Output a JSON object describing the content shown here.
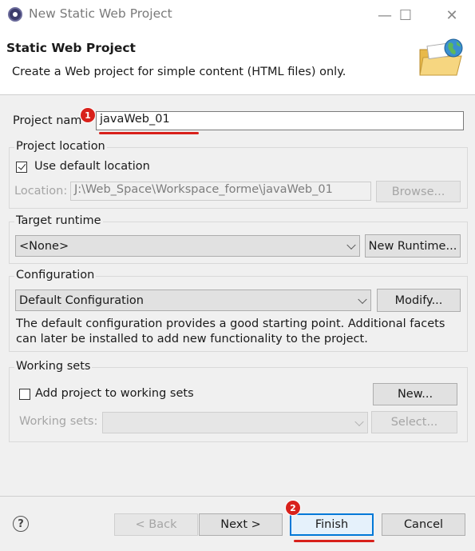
{
  "window": {
    "title": "New Static Web Project",
    "minimize_glyph": "—",
    "maximize_glyph": "☐",
    "close_glyph": "✕"
  },
  "header": {
    "title": "Static Web Project",
    "description": "Create a Web project for simple content (HTML files) only."
  },
  "project_name": {
    "label": "Project nam",
    "value": "javaWeb_01"
  },
  "project_location": {
    "group_label": "Project location",
    "use_default_label": "Use default location",
    "use_default_checked": true,
    "location_label": "Location:",
    "location_value": "J:\\Web_Space\\Workspace_forme\\javaWeb_01",
    "browse_label": "Browse..."
  },
  "target_runtime": {
    "group_label": "Target runtime",
    "selected": "<None>",
    "new_runtime_label": "New Runtime..."
  },
  "configuration": {
    "group_label": "Configuration",
    "selected": "Default Configuration",
    "modify_label": "Modify...",
    "description_line1": "The default configuration provides a good starting point. Additional facets",
    "description_line2": "can later be installed to add new functionality to the project."
  },
  "working_sets": {
    "group_label": "Working sets",
    "add_label": "Add project to working sets",
    "add_checked": false,
    "new_label": "New...",
    "sets_label": "Working sets:",
    "sets_value": "",
    "select_label": "Select..."
  },
  "footer": {
    "help_glyph": "?",
    "back_label": "< Back",
    "next_label": "Next >",
    "finish_label": "Finish",
    "cancel_label": "Cancel"
  },
  "annotations": {
    "badge1": "1",
    "badge2": "2",
    "color": "#d8211b"
  }
}
